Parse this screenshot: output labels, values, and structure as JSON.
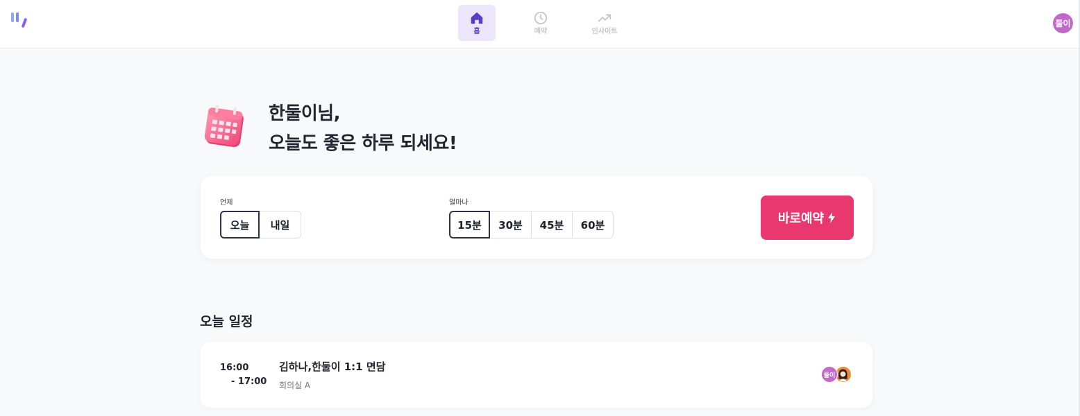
{
  "nav": {
    "items": [
      {
        "label": "홈",
        "icon": "home-icon",
        "active": true
      },
      {
        "label": "예약",
        "icon": "clock-icon",
        "active": false
      },
      {
        "label": "인사이트",
        "icon": "trending-up-icon",
        "active": false
      }
    ]
  },
  "user": {
    "avatar_text": "둘이",
    "avatar_color": "#c268c9"
  },
  "greeting": {
    "line1": "한둘이님,",
    "line2": "오늘도 좋은 하루 되세요!"
  },
  "booking": {
    "when_label": "언제",
    "when_options": [
      "오늘",
      "내일"
    ],
    "when_selected": "오늘",
    "duration_label": "얼마나",
    "duration_options": [
      "15분",
      "30분",
      "45분",
      "60분"
    ],
    "duration_selected": "15분",
    "quick_book_label": "바로예약",
    "quick_book_color": "#e8386f"
  },
  "schedule": {
    "title": "오늘 일정",
    "events": [
      {
        "start": "16:00",
        "end": "- 17:00",
        "title": "김하나,한둘이 1:1 면담",
        "room": "회의실 A",
        "attendees": [
          {
            "avatar_text": "둘이",
            "color": "#c268c9"
          },
          {
            "avatar_text": "",
            "color": "#f0893a"
          }
        ]
      }
    ]
  },
  "colors": {
    "accent": "#5b3cc4",
    "active_nav_bg": "#ebe6fb",
    "page_bg": "#f8f9fb"
  }
}
